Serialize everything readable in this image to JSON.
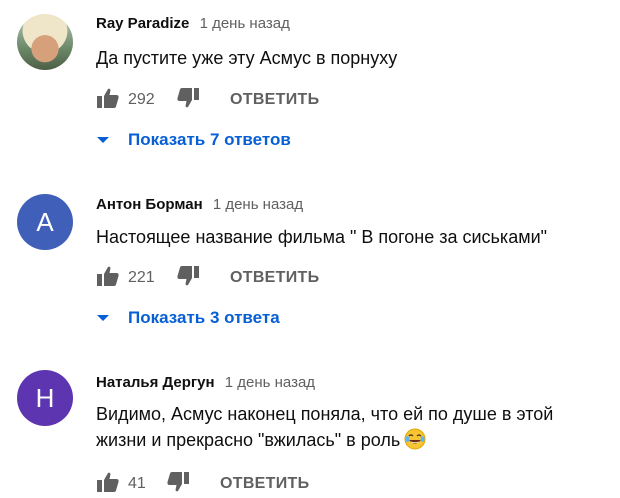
{
  "colors": {
    "link": "#065fd4",
    "muted": "#606060",
    "avatar_anton": "#3f5fb8",
    "avatar_natalya": "#5e35b1"
  },
  "comments": [
    {
      "author": "Ray Paradize",
      "time": "1 день назад",
      "text": "Да пустите уже эту Асмус в порнуху",
      "likes": "292",
      "reply_label": "ОТВЕТИТЬ",
      "show_replies": "Показать 7 ответов",
      "avatar": "photo"
    },
    {
      "author": "Антон Борман",
      "time": "1 день назад",
      "text": "Настоящее название фильма \" В погоне за сиськами\"",
      "likes": "221",
      "reply_label": "ОТВЕТИТЬ",
      "show_replies": "Показать 3 ответа",
      "avatar": "A"
    },
    {
      "author": "Наталья Дергун",
      "time": "1 день назад",
      "text_line1": "Видимо, Асмус наконец поняла, что ей по душе в этой",
      "text_line2": "жизни и прекрасно \"вжилась\" в роль",
      "emoji": "face-with-tears-of-joy-icon",
      "likes": "41",
      "reply_label": "ОТВЕТИТЬ",
      "avatar": "H"
    }
  ]
}
